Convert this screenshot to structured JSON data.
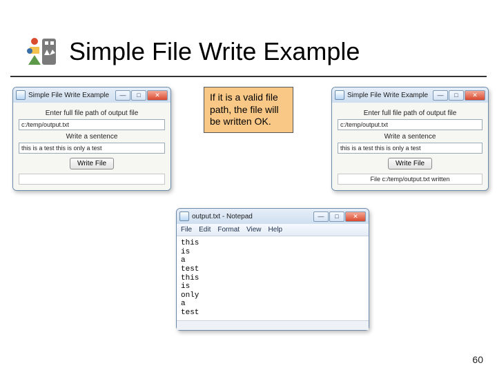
{
  "slide": {
    "title": "Simple File Write Example",
    "page_number": "60"
  },
  "callout": {
    "text": "If it is a valid file path, the file will be written OK."
  },
  "app_left": {
    "title": "Simple File Write Example",
    "label_path": "Enter full file path of output file",
    "value_path": "c:/temp/output.txt",
    "label_sentence": "Write a sentence",
    "value_sentence": "this is a test this is only a test",
    "button": "Write File",
    "status": ""
  },
  "app_right": {
    "title": "Simple File Write Example",
    "label_path": "Enter full file path of output file",
    "value_path": "c:/temp/output.txt",
    "label_sentence": "Write a sentence",
    "value_sentence": "this is a test this is only a test",
    "button": "Write File",
    "status": "File c:/temp/output.txt written"
  },
  "notepad": {
    "title": "output.txt - Notepad",
    "menu": {
      "file": "File",
      "edit": "Edit",
      "format": "Format",
      "view": "View",
      "help": "Help"
    },
    "content": "this\nis\na\ntest\nthis\nis\nonly\na\ntest"
  },
  "win_controls": {
    "min": "—",
    "max": "□",
    "close": "✕"
  }
}
